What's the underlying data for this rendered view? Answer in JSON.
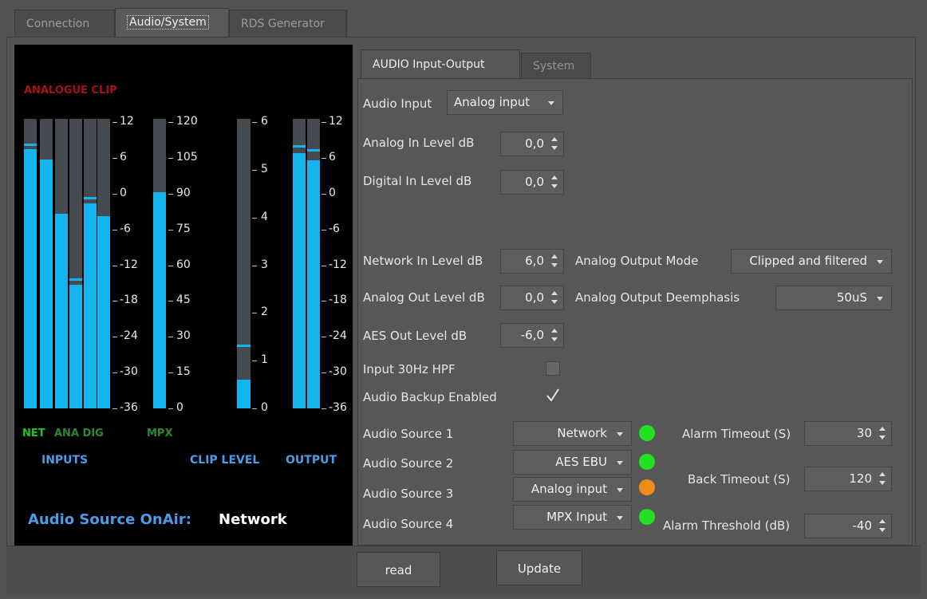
{
  "tabs": [
    "Connection",
    "Audio/System",
    "RDS Generator"
  ],
  "meter_panel": {
    "analogue_clip": "ANALOGUE CLIP",
    "inputs_scale": [
      "12",
      "6",
      "0",
      "-6",
      "-12",
      "-18",
      "-24",
      "-30",
      "-36"
    ],
    "mpx_scale": [
      "120",
      "105",
      "90",
      "75",
      "60",
      "45",
      "30",
      "15",
      "0"
    ],
    "clip_scale": [
      "6",
      "5",
      "4",
      "3",
      "2",
      "1",
      "0"
    ],
    "output_scale": [
      "12",
      "6",
      "0",
      "-6",
      "-12",
      "-18",
      "-24",
      "-30",
      "-36"
    ],
    "legend_net": "NET",
    "legend_ana_dig": "ANA DIG",
    "legend_mpx": "MPX",
    "inputs": "INPUTS",
    "clip_level": "CLIP LEVEL",
    "output": "OUTPUT",
    "onair_label": "Audio Source OnAir:",
    "onair_value": "Network",
    "levels_note": "bar fill fractions (0-1) of meter height",
    "input_levels": [
      0.895,
      0.86,
      0.672,
      0.426,
      0.708,
      0.664
    ],
    "input_peaks": [
      0.914,
      null,
      null,
      0.45,
      0.73,
      null
    ],
    "mpx_level": 0.746,
    "clip_level_value": 0.098,
    "clip_peak": 0.22,
    "output_levels": [
      0.882,
      0.858
    ],
    "output_peaks": [
      0.91,
      0.895
    ]
  },
  "inner_tabs": [
    "AUDIO Input-Output",
    "System"
  ],
  "form": {
    "audio_input_label": "Audio Input",
    "audio_input_value": "Analog input",
    "analog_in_label": "Analog In Level dB",
    "analog_in_value": "0,0",
    "digital_in_label": "Digital In Level dB",
    "digital_in_value": "0,0",
    "network_in_label": "Network In Level dB",
    "network_in_value": "6,0",
    "analog_out_label": "Analog Out Level dB",
    "analog_out_value": "0,0",
    "aes_out_label": "AES Out Level dB",
    "aes_out_value": "-6,0",
    "analog_output_mode_label": "Analog Output Mode",
    "analog_output_mode_value": "Clipped and filtered",
    "analog_output_deemph_label": "Analog Output Deemphasis",
    "analog_output_deemph_value": "50uS",
    "hpf_label": "Input 30Hz HPF",
    "hpf_checked": false,
    "backup_label": "Audio Backup Enabled",
    "backup_checked": true,
    "sources": [
      {
        "label": "Audio Source 1",
        "value": "Network",
        "led": "#22e022"
      },
      {
        "label": "Audio Source 2",
        "value": "AES EBU",
        "led": "#22e022"
      },
      {
        "label": "Audio Source 3",
        "value": "Analog input",
        "led": "#f08c14"
      },
      {
        "label": "Audio Source 4",
        "value": "MPX Input",
        "led": "#22e022"
      }
    ],
    "alarm_timeout_label": "Alarm Timeout (S)",
    "alarm_timeout_value": "30",
    "back_timeout_label": "Back Timeout (S)",
    "back_timeout_value": "120",
    "alarm_threshold_label": "Alarm Threshold (dB)",
    "alarm_threshold_value": "-40"
  },
  "buttons": {
    "read": "read",
    "update": "Update"
  },
  "colors": {
    "meter_blue": "#14b5ef",
    "clip_red": "#aa1111",
    "legend_green": "#1ec81e",
    "legend_dark_green": "#2a8a2a",
    "heading_blue": "#4a9de8"
  }
}
